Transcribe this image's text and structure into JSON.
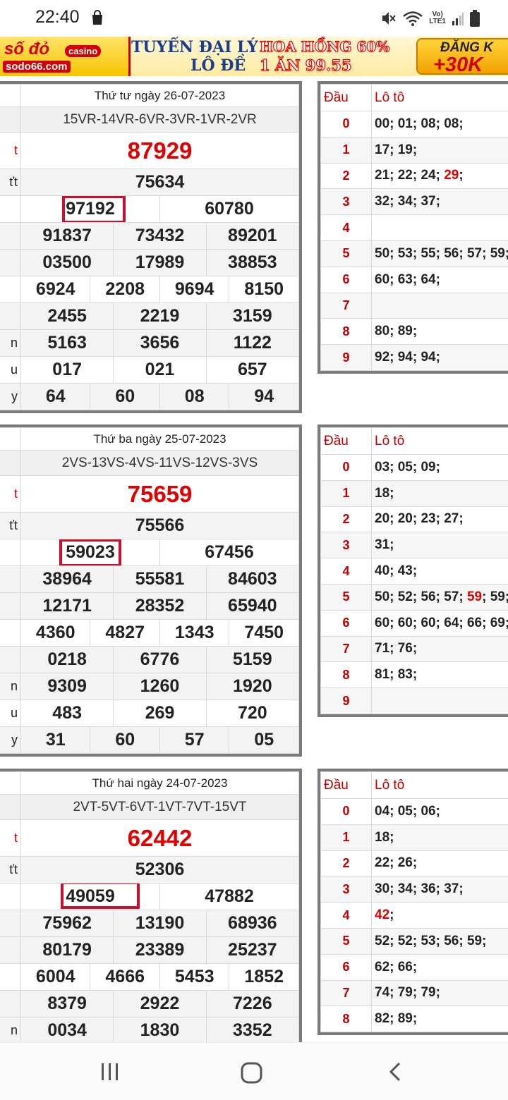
{
  "status_bar": {
    "time": "22:40",
    "network_label_top": "Vo)",
    "network_label_bottom": "LTE1"
  },
  "banner": {
    "logo_text": "số đỏ",
    "logo_badge": "casino",
    "logo_site": "sodo66.com",
    "line1_left": "TUYỂN ĐẠI LÝ",
    "line1_right": "HOA HỒNG 60%",
    "line2_left": "LÔ ĐỀ",
    "line2_right": "1 ĂN 99.55",
    "cta_top": "ĐĂNG K",
    "cta_bottom": "+30K"
  },
  "days": [
    {
      "date": "Thứ tư ngày 26-07-2023",
      "codes": "15VR-14VR-6VR-3VR-1VR-2VR",
      "prize_labels": [
        "t",
        "ťt",
        "",
        "",
        "",
        "",
        "n",
        "u",
        "y"
      ],
      "special": "87929",
      "first": "75634",
      "second": [
        "97192",
        "60780"
      ],
      "third_a": [
        "91837",
        "73432",
        "89201"
      ],
      "third_b": [
        "03500",
        "17989",
        "38853"
      ],
      "fourth": [
        "6924",
        "2208",
        "9694",
        "8150"
      ],
      "fifth_a": [
        "2455",
        "2219",
        "3159"
      ],
      "fifth_b": [
        "5163",
        "3656",
        "1122"
      ],
      "sixth": [
        "017",
        "021",
        "657"
      ],
      "seventh": [
        "64",
        "60",
        "08",
        "94"
      ],
      "loto_head": [
        "Đầu",
        "Lô tô"
      ],
      "loto": [
        {
          "dau": "0",
          "parts": [
            "00; 01; 08; 08;"
          ]
        },
        {
          "dau": "1",
          "parts": [
            "17; 19;"
          ]
        },
        {
          "dau": "2",
          "parts": [
            "21; 22; 24; ",
            "29",
            ";"
          ]
        },
        {
          "dau": "3",
          "parts": [
            "32; 34; 37;"
          ]
        },
        {
          "dau": "4",
          "parts": [
            ""
          ]
        },
        {
          "dau": "5",
          "parts": [
            "50; 53; 55; 56; 57; 59;"
          ]
        },
        {
          "dau": "6",
          "parts": [
            "60; 63; 64;"
          ]
        },
        {
          "dau": "7",
          "parts": [
            ""
          ]
        },
        {
          "dau": "8",
          "parts": [
            "80; 89;"
          ]
        },
        {
          "dau": "9",
          "parts": [
            "92; 94; 94;"
          ]
        }
      ]
    },
    {
      "date": "Thứ ba ngày 25-07-2023",
      "codes": "2VS-13VS-4VS-11VS-12VS-3VS",
      "prize_labels": [
        "t",
        "ťt",
        "",
        "",
        "",
        "",
        "n",
        "u",
        "y"
      ],
      "special": "75659",
      "first": "75566",
      "second": [
        "59023",
        "67456"
      ],
      "third_a": [
        "38964",
        "55581",
        "84603"
      ],
      "third_b": [
        "12171",
        "28352",
        "65940"
      ],
      "fourth": [
        "4360",
        "4827",
        "1343",
        "7450"
      ],
      "fifth_a": [
        "0218",
        "6776",
        "5159"
      ],
      "fifth_b": [
        "9309",
        "1260",
        "1920"
      ],
      "sixth": [
        "483",
        "269",
        "720"
      ],
      "seventh": [
        "31",
        "60",
        "57",
        "05"
      ],
      "loto_head": [
        "Đầu",
        "Lô tô"
      ],
      "loto": [
        {
          "dau": "0",
          "parts": [
            "03; 05; 09;"
          ]
        },
        {
          "dau": "1",
          "parts": [
            "18;"
          ]
        },
        {
          "dau": "2",
          "parts": [
            "20; 20; 23; 27;"
          ]
        },
        {
          "dau": "3",
          "parts": [
            "31;"
          ]
        },
        {
          "dau": "4",
          "parts": [
            "40; 43;"
          ]
        },
        {
          "dau": "5",
          "parts": [
            "50; 52; 56; 57; ",
            "59",
            "; 59;"
          ]
        },
        {
          "dau": "6",
          "parts": [
            "60; 60; 60; 64; 66; 69;"
          ]
        },
        {
          "dau": "7",
          "parts": [
            "71; 76;"
          ]
        },
        {
          "dau": "8",
          "parts": [
            "81; 83;"
          ]
        },
        {
          "dau": "9",
          "parts": [
            ""
          ]
        }
      ]
    },
    {
      "date": "Thứ hai ngày 24-07-2023",
      "codes": "2VT-5VT-6VT-1VT-7VT-15VT",
      "prize_labels": [
        "t",
        "ťt",
        "",
        "",
        "",
        "",
        "n",
        "u",
        "y"
      ],
      "special": "62442",
      "first": "52306",
      "second": [
        "49059",
        "47882"
      ],
      "third_a": [
        "75962",
        "13190",
        "68936"
      ],
      "third_b": [
        "80179",
        "23389",
        "25237"
      ],
      "fourth": [
        "6004",
        "4666",
        "5453",
        "1852"
      ],
      "fifth_a": [
        "8379",
        "2922",
        "7226"
      ],
      "fifth_b": [
        "0034",
        "1830",
        "3352"
      ],
      "sixth": [],
      "seventh": [],
      "loto_head": [
        "Đầu",
        "Lô tô"
      ],
      "loto": [
        {
          "dau": "0",
          "parts": [
            "04; 05; 06;"
          ]
        },
        {
          "dau": "1",
          "parts": [
            "18;"
          ]
        },
        {
          "dau": "2",
          "parts": [
            "22; 26;"
          ]
        },
        {
          "dau": "3",
          "parts": [
            "30; 34; 36; 37;"
          ]
        },
        {
          "dau": "4",
          "parts": [
            "",
            "42",
            ";"
          ]
        },
        {
          "dau": "5",
          "parts": [
            "52; 52; 53; 56; 59;"
          ]
        },
        {
          "dau": "6",
          "parts": [
            "62; 66;"
          ]
        },
        {
          "dau": "7",
          "parts": [
            "74; 79; 79;"
          ]
        },
        {
          "dau": "8",
          "parts": [
            "82; 89;"
          ]
        }
      ]
    }
  ],
  "colors": {
    "special_red": "#e00000",
    "frame_gray": "#7a7a7a",
    "loto_red": "#c00000",
    "circle_red": "#c8102e"
  },
  "nav": {
    "recents_icon": "recents-icon",
    "home_icon": "home-icon",
    "back_icon": "back-icon"
  }
}
